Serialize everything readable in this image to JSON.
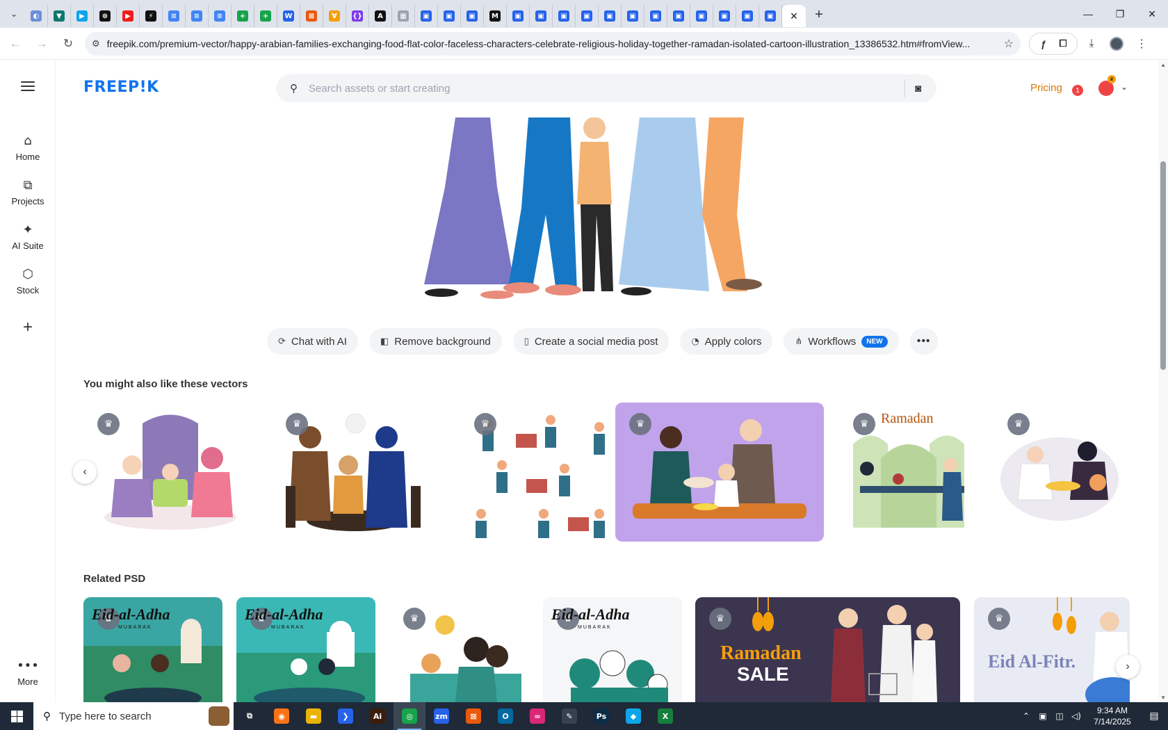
{
  "browser": {
    "tabs": [
      {
        "icon": "globe-icon",
        "color": "#6b8fd6",
        "glyph": "◐"
      },
      {
        "icon": "shield-icon",
        "color": "#0f766e",
        "glyph": "▼"
      },
      {
        "icon": "play-icon",
        "color": "#0ea5e9",
        "glyph": "▶"
      },
      {
        "icon": "openai-icon",
        "color": "#111111",
        "glyph": "⊛"
      },
      {
        "icon": "youtube-icon",
        "color": "#ef1c1c",
        "glyph": "▶"
      },
      {
        "icon": "bolt-icon",
        "color": "#111111",
        "glyph": "⚡"
      },
      {
        "icon": "docs-icon",
        "color": "#4285f4",
        "glyph": "≡"
      },
      {
        "icon": "docs-icon",
        "color": "#4285f4",
        "glyph": "≡"
      },
      {
        "icon": "docs-icon",
        "color": "#4285f4",
        "glyph": "≡"
      },
      {
        "icon": "sheets-icon",
        "color": "#16a34a",
        "glyph": "+"
      },
      {
        "icon": "sheets-icon",
        "color": "#16a34a",
        "glyph": "+"
      },
      {
        "icon": "word-icon",
        "color": "#2563eb",
        "glyph": "W"
      },
      {
        "icon": "xampp-icon",
        "color": "#ea580c",
        "glyph": "⊠"
      },
      {
        "icon": "vee-icon",
        "color": "#f59e0b",
        "glyph": "∀"
      },
      {
        "icon": "braces-icon",
        "color": "#7c3aed",
        "glyph": "{}"
      },
      {
        "icon": "ai-icon",
        "color": "#111111",
        "glyph": "A"
      },
      {
        "icon": "grid-icon",
        "color": "#9ca3af",
        "glyph": "▦"
      },
      {
        "icon": "forms-icon",
        "color": "#2563eb",
        "glyph": "▣"
      },
      {
        "icon": "forms-icon",
        "color": "#2563eb",
        "glyph": "▣"
      },
      {
        "icon": "forms-icon",
        "color": "#2563eb",
        "glyph": "▣"
      },
      {
        "icon": "medium-icon",
        "color": "#111111",
        "glyph": "M"
      },
      {
        "icon": "forms-icon",
        "color": "#2563eb",
        "glyph": "▣"
      },
      {
        "icon": "forms-icon",
        "color": "#2563eb",
        "glyph": "▣"
      },
      {
        "icon": "forms-icon",
        "color": "#2563eb",
        "glyph": "▣"
      },
      {
        "icon": "forms-icon",
        "color": "#2563eb",
        "glyph": "▣"
      },
      {
        "icon": "forms-icon",
        "color": "#2563eb",
        "glyph": "▣"
      },
      {
        "icon": "forms-icon",
        "color": "#2563eb",
        "glyph": "▣"
      },
      {
        "icon": "forms-icon",
        "color": "#2563eb",
        "glyph": "▣"
      },
      {
        "icon": "forms-icon",
        "color": "#2563eb",
        "glyph": "▣"
      },
      {
        "icon": "forms-icon",
        "color": "#2563eb",
        "glyph": "▣"
      },
      {
        "icon": "forms-icon",
        "color": "#2563eb",
        "glyph": "▣"
      },
      {
        "icon": "forms-icon",
        "color": "#2563eb",
        "glyph": "▣"
      },
      {
        "icon": "forms-icon",
        "color": "#2563eb",
        "glyph": "▣"
      }
    ],
    "url": "freepik.com/premium-vector/happy-arabian-families-exchanging-food-flat-color-faceless-characters-celebrate-religious-holiday-together-ramadan-isolated-cartoon-illustration_13386532.htm#fromView..."
  },
  "site": {
    "logo": "FREEP!K",
    "search_placeholder": "Search assets or start creating",
    "pricing": "Pricing",
    "notification_count": "1",
    "brand_color": "#1273eb",
    "pricing_color": "#d97706"
  },
  "sidebar": {
    "items": [
      {
        "label": "Home",
        "icon": "home-icon"
      },
      {
        "label": "Projects",
        "icon": "projects-icon"
      },
      {
        "label": "AI Suite",
        "icon": "sparkles-icon"
      },
      {
        "label": "Stock",
        "icon": "stock-icon"
      }
    ],
    "more": "More"
  },
  "actions": [
    {
      "label": "Chat with AI",
      "icon": "chat-icon"
    },
    {
      "label": "Remove background",
      "icon": "remove-bg-icon"
    },
    {
      "label": "Create a social media post",
      "icon": "phone-icon"
    },
    {
      "label": "Apply colors",
      "icon": "palette-icon"
    },
    {
      "label": "Workflows",
      "icon": "workflow-icon",
      "badge": "NEW"
    }
  ],
  "sections": {
    "vectors_title": "You might also like these vectors",
    "psd_title": "Related PSD"
  },
  "vector_cards": [
    {
      "label": ""
    },
    {
      "label": ""
    },
    {
      "label": ""
    },
    {
      "label": ""
    },
    {
      "label": "Ramadan"
    },
    {
      "label": ""
    }
  ],
  "psd_cards": [
    {
      "title": "Eid-al-Adha",
      "sub": "MUBARAK"
    },
    {
      "title": "Eid-al-Adha",
      "sub": "MUBARAK"
    },
    {
      "title": "",
      "sub": ""
    },
    {
      "title": "Eid-al-Adha",
      "sub": "MUBARAK"
    },
    {
      "title": "Ramadan",
      "sub": "SALE"
    },
    {
      "title": "Eid Al-Fitr.",
      "sub": ""
    }
  ],
  "taskbar": {
    "search_placeholder": "Type here to search",
    "apps": [
      {
        "icon": "task-view-icon",
        "color": "#1f2937",
        "glyph": "⧉"
      },
      {
        "icon": "firefox-icon",
        "color": "#f97316",
        "glyph": "◉"
      },
      {
        "icon": "file-explorer-icon",
        "color": "#eab308",
        "glyph": "▬"
      },
      {
        "icon": "vscode-icon",
        "color": "#2563eb",
        "glyph": "❯"
      },
      {
        "icon": "illustrator-icon",
        "color": "#3b1d0c",
        "glyph": "Ai"
      },
      {
        "icon": "chrome-icon",
        "color": "#16a34a",
        "glyph": "◎"
      },
      {
        "icon": "zoom-icon",
        "color": "#2563eb",
        "glyph": "zm"
      },
      {
        "icon": "xampp-icon",
        "color": "#ea580c",
        "glyph": "⊠"
      },
      {
        "icon": "outlook-icon",
        "color": "#0369a1",
        "glyph": "O"
      },
      {
        "icon": "creative-cloud-icon",
        "color": "#db2777",
        "glyph": "∞"
      },
      {
        "icon": "pen-icon",
        "color": "#374151",
        "glyph": "✎"
      },
      {
        "icon": "photoshop-icon",
        "color": "#0c2d48",
        "glyph": "Ps"
      },
      {
        "icon": "diamond-app-icon",
        "color": "#0ea5e9",
        "glyph": "◆"
      },
      {
        "icon": "excel-icon",
        "color": "#15803d",
        "glyph": "X"
      }
    ],
    "time": "9:34 AM",
    "date": "7/14/2025"
  }
}
